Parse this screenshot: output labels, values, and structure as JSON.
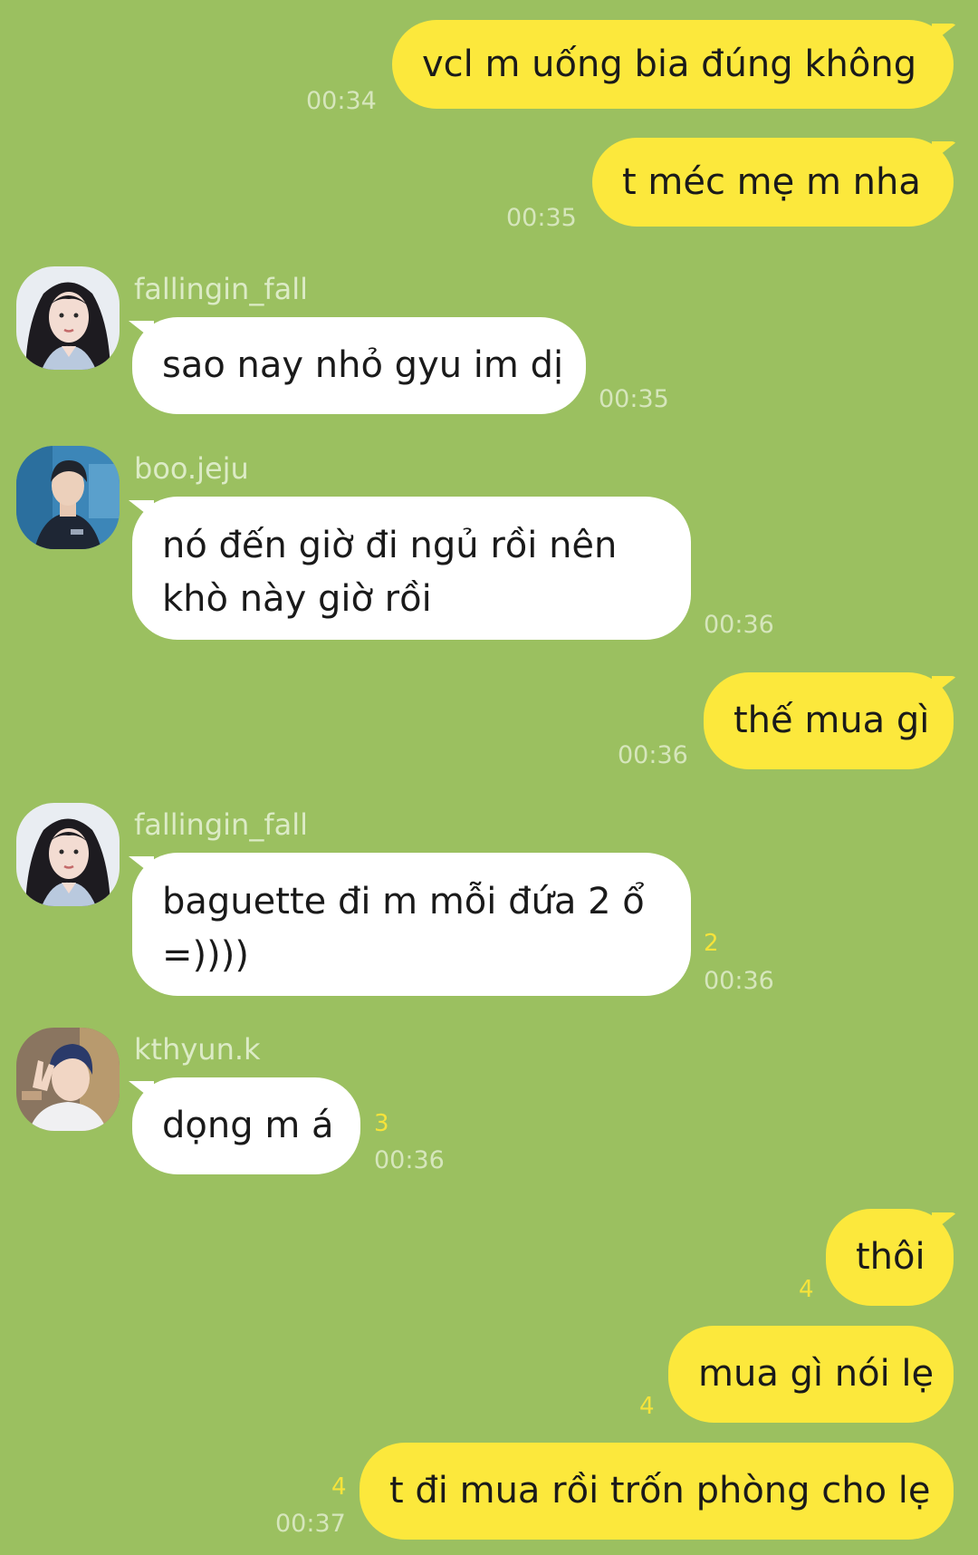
{
  "messages": [
    {
      "text": "vcl m uống bia đúng không",
      "time": "00:34"
    },
    {
      "text": "t méc mẹ m nha",
      "time": "00:35"
    },
    {
      "sender": "fallingin_fall",
      "text": "sao nay nhỏ gyu im dị",
      "time": "00:35"
    },
    {
      "sender": "boo.jeju",
      "text": "nó đến giờ đi ngủ rồi nên khò này giờ rồi",
      "time": "00:36"
    },
    {
      "text": "thế mua gì",
      "time": "00:36"
    },
    {
      "sender": "fallingin_fall",
      "text": "baguette đi m mỗi đứa 2 ổ =))))",
      "time": "00:36",
      "unread": "2"
    },
    {
      "sender": "kthyun.k",
      "text": "dọng m á",
      "time": "00:36",
      "unread": "3"
    },
    {
      "text": "thôi",
      "unread": "4"
    },
    {
      "text": "mua gì nói lẹ",
      "unread": "4"
    },
    {
      "text": "t đi mua rồi trốn phòng cho lẹ",
      "time": "00:37",
      "unread": "4"
    }
  ],
  "colors": {
    "background": "#9bc060",
    "outgoing_bubble": "#fce83c",
    "incoming_bubble": "#ffffff",
    "unread_count": "#f6e33a"
  },
  "avatars": {
    "fallingin_fall": "avatar-girl-dark-hair",
    "boo.jeju": "avatar-boy-navy-shirt",
    "kthyun.k": "avatar-boy-peace-sign"
  }
}
